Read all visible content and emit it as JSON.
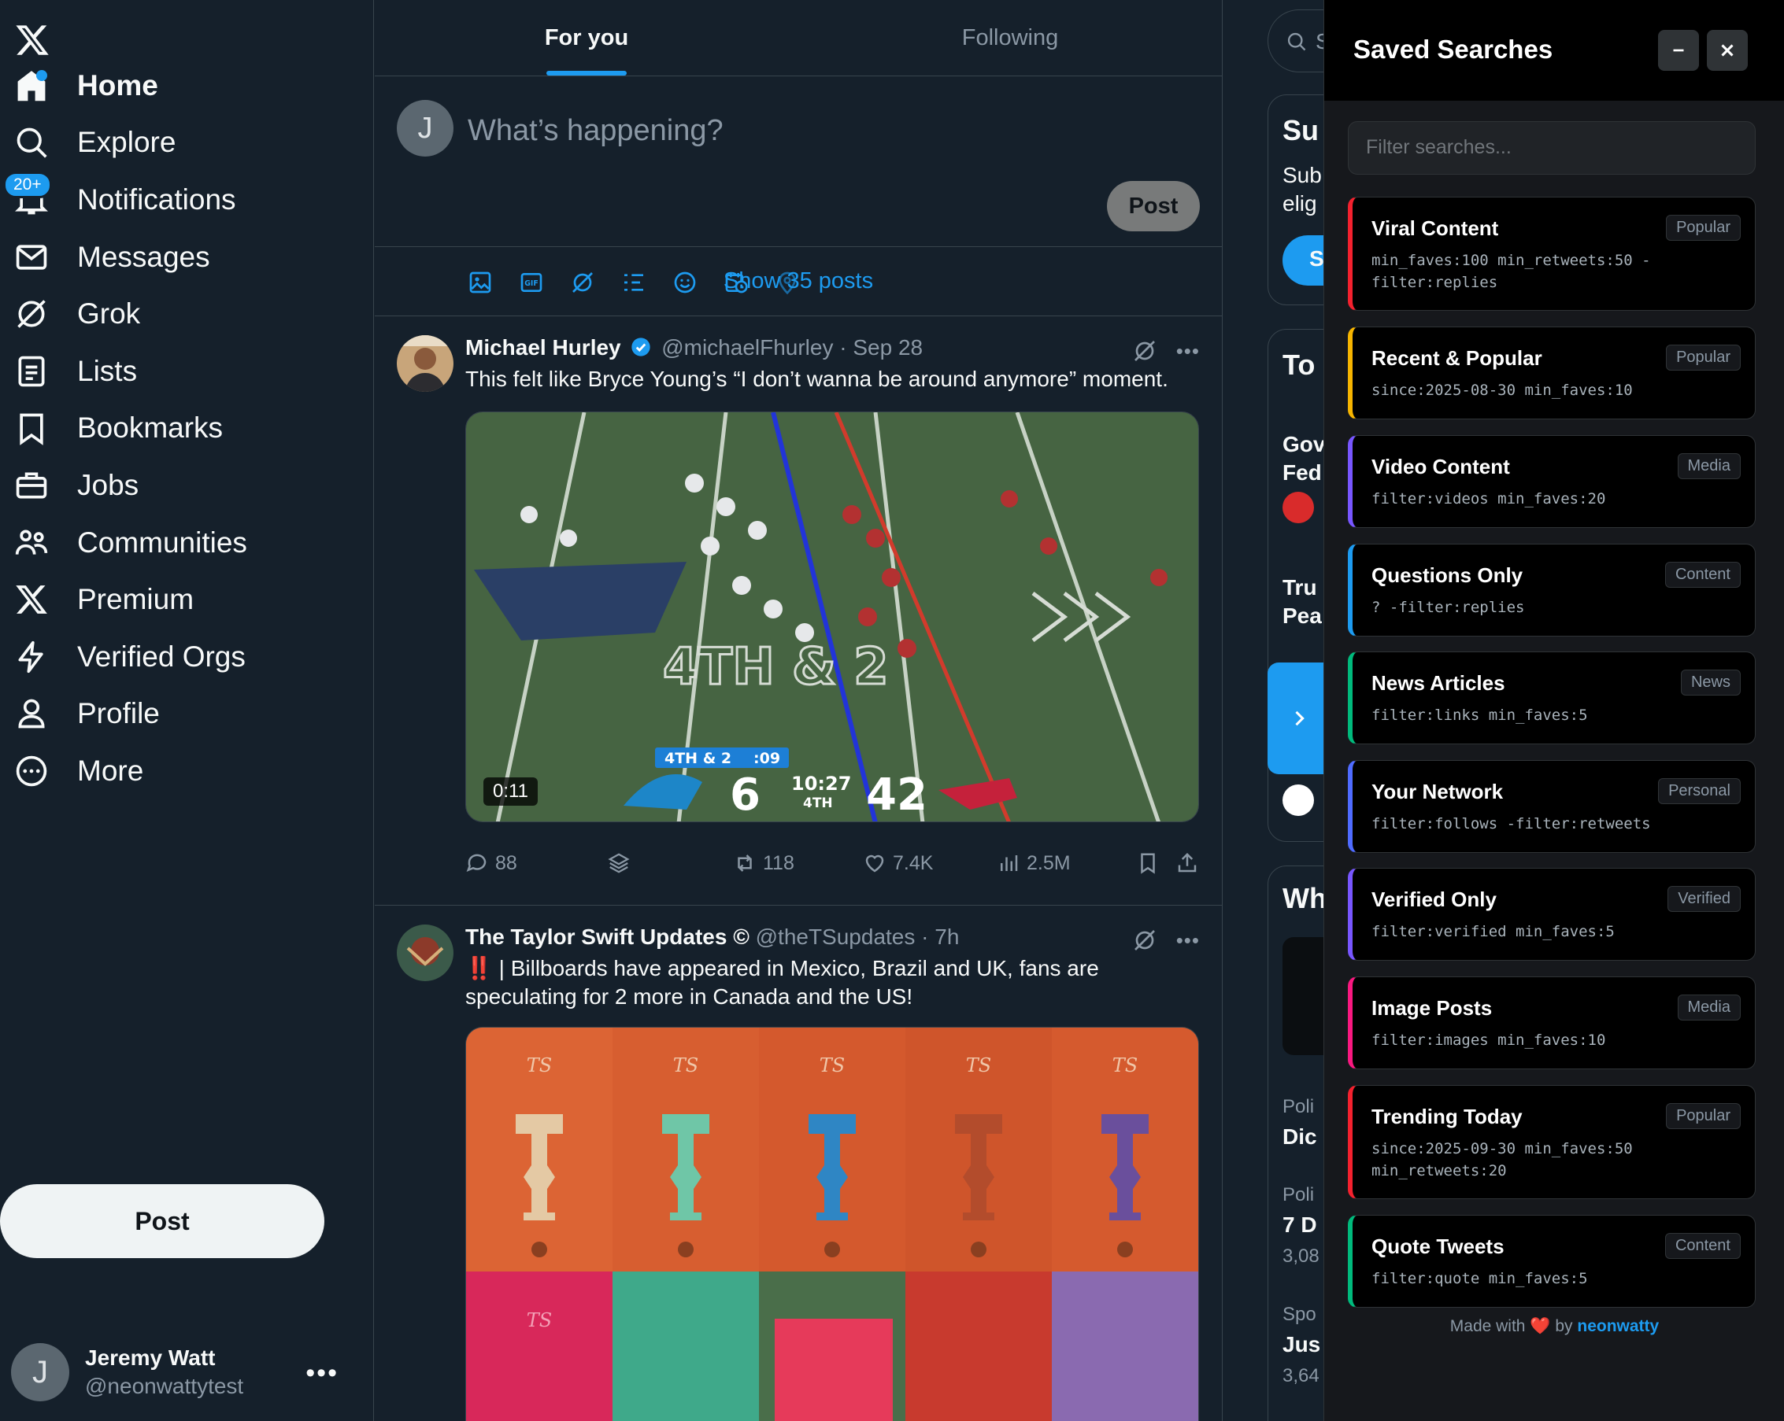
{
  "nav": {
    "items": [
      {
        "label": "Home",
        "icon": "home-icon"
      },
      {
        "label": "Explore",
        "icon": "search-icon"
      },
      {
        "label": "Notifications",
        "icon": "bell-icon",
        "badge": "20+"
      },
      {
        "label": "Messages",
        "icon": "mail-icon"
      },
      {
        "label": "Grok",
        "icon": "grok-icon"
      },
      {
        "label": "Lists",
        "icon": "list-icon"
      },
      {
        "label": "Bookmarks",
        "icon": "bookmark-icon"
      },
      {
        "label": "Jobs",
        "icon": "briefcase-icon"
      },
      {
        "label": "Communities",
        "icon": "communities-icon"
      },
      {
        "label": "Premium",
        "icon": "x-icon"
      },
      {
        "label": "Verified Orgs",
        "icon": "lightning-icon"
      },
      {
        "label": "Profile",
        "icon": "person-icon"
      },
      {
        "label": "More",
        "icon": "more-circle-icon"
      }
    ],
    "post_label": "Post"
  },
  "account": {
    "avatar_letter": "J",
    "name": "Jeremy Watt",
    "handle": "@neonwattytest"
  },
  "feed": {
    "tabs": [
      {
        "label": "For you"
      },
      {
        "label": "Following"
      }
    ],
    "compose": {
      "avatar_letter": "J",
      "placeholder": "What’s happening?",
      "post_label": "Post"
    },
    "show_posts": "Show 35 posts",
    "tweets": [
      {
        "name": "Michael Hurley",
        "handle": "@michaelFhurley",
        "time": "· Sep 28",
        "text": "This felt like Bryce Young’s “I don’t wanna be around anymore” moment.",
        "video_time": "0:11",
        "scoreboard": {
          "down": "4TH & 2",
          "clock": ":09",
          "home": "6",
          "game_time": "10:27",
          "quarter": "4TH",
          "away": "42",
          "field_text": "4TH & 2"
        },
        "stats": {
          "replies": "88",
          "retweets": "118",
          "likes": "7.4K",
          "views": "2.5M"
        }
      },
      {
        "name": "The Taylor Swift Updates ©",
        "handle": "@theTSupdates",
        "time": "· 7h",
        "text": "‼️ | Billboards have appeared in Mexico, Brazil and UK, fans are speculating for 2 more in Canada and the US!",
        "poster_mark": "TS"
      }
    ]
  },
  "right": {
    "fragments": [
      "Su",
      "Sub",
      "elig",
      "S",
      "To",
      "Gov",
      "Fed",
      "Tru",
      "Pea",
      "Wh",
      "Poli",
      "Dic",
      "Poli",
      "7 D",
      "3,08",
      "Spo",
      "Jus",
      "3,64"
    ]
  },
  "panel": {
    "title": "Saved Searches",
    "filter_placeholder": "Filter searches...",
    "searches": [
      {
        "name": "Viral Content",
        "tag": "Popular",
        "query": "min_faves:100 min_retweets:50 -filter:replies",
        "color": "#f4212e"
      },
      {
        "name": "Recent & Popular",
        "tag": "Popular",
        "query": "since:2025-08-30 min_faves:10",
        "color": "#f7b500"
      },
      {
        "name": "Video Content",
        "tag": "Media",
        "query": "filter:videos min_faves:20",
        "color": "#7856ff"
      },
      {
        "name": "Questions Only",
        "tag": "Content",
        "query": "? -filter:replies",
        "color": "#1d9bf0"
      },
      {
        "name": "News Articles",
        "tag": "News",
        "query": "filter:links min_faves:5",
        "color": "#00ba7c"
      },
      {
        "name": "Your Network",
        "tag": "Personal",
        "query": "filter:follows -filter:retweets",
        "color": "#4f6bff"
      },
      {
        "name": "Verified Only",
        "tag": "Verified",
        "query": "filter:verified min_faves:5",
        "color": "#7856ff"
      },
      {
        "name": "Image Posts",
        "tag": "Media",
        "query": "filter:images min_faves:10",
        "color": "#f91880"
      },
      {
        "name": "Trending Today",
        "tag": "Popular",
        "query": "since:2025-09-30 min_faves:50 min_retweets:20",
        "color": "#f4212e"
      },
      {
        "name": "Quote Tweets",
        "tag": "Content",
        "query": "filter:quote min_faves:5",
        "color": "#00ba7c"
      }
    ],
    "footer": {
      "prefix": "Made with",
      "heart": "❤️",
      "by": "by",
      "author": "neonwatty"
    }
  },
  "colors": {
    "accent": "#1d9bf0",
    "background": "#15202b",
    "panel": "#000000"
  }
}
